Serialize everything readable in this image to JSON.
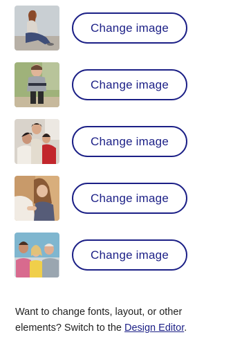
{
  "images": [
    {
      "button_label": "Change image",
      "thumbnail_icon": "woman-sitting-photo"
    },
    {
      "button_label": "Change image",
      "thumbnail_icon": "toddler-photo"
    },
    {
      "button_label": "Change image",
      "thumbnail_icon": "family-hug-photo"
    },
    {
      "button_label": "Change image",
      "thumbnail_icon": "girl-with-horse-photo"
    },
    {
      "button_label": "Change image",
      "thumbnail_icon": "family-group-photo"
    }
  ],
  "footer": {
    "text_before": "Want to change fonts, layout, or other elements? Switch to the ",
    "link_label": "Design Editor",
    "text_after": "."
  },
  "colors": {
    "accent": "#1b1f86",
    "text": "#1e1e1e",
    "background": "#ffffff"
  }
}
